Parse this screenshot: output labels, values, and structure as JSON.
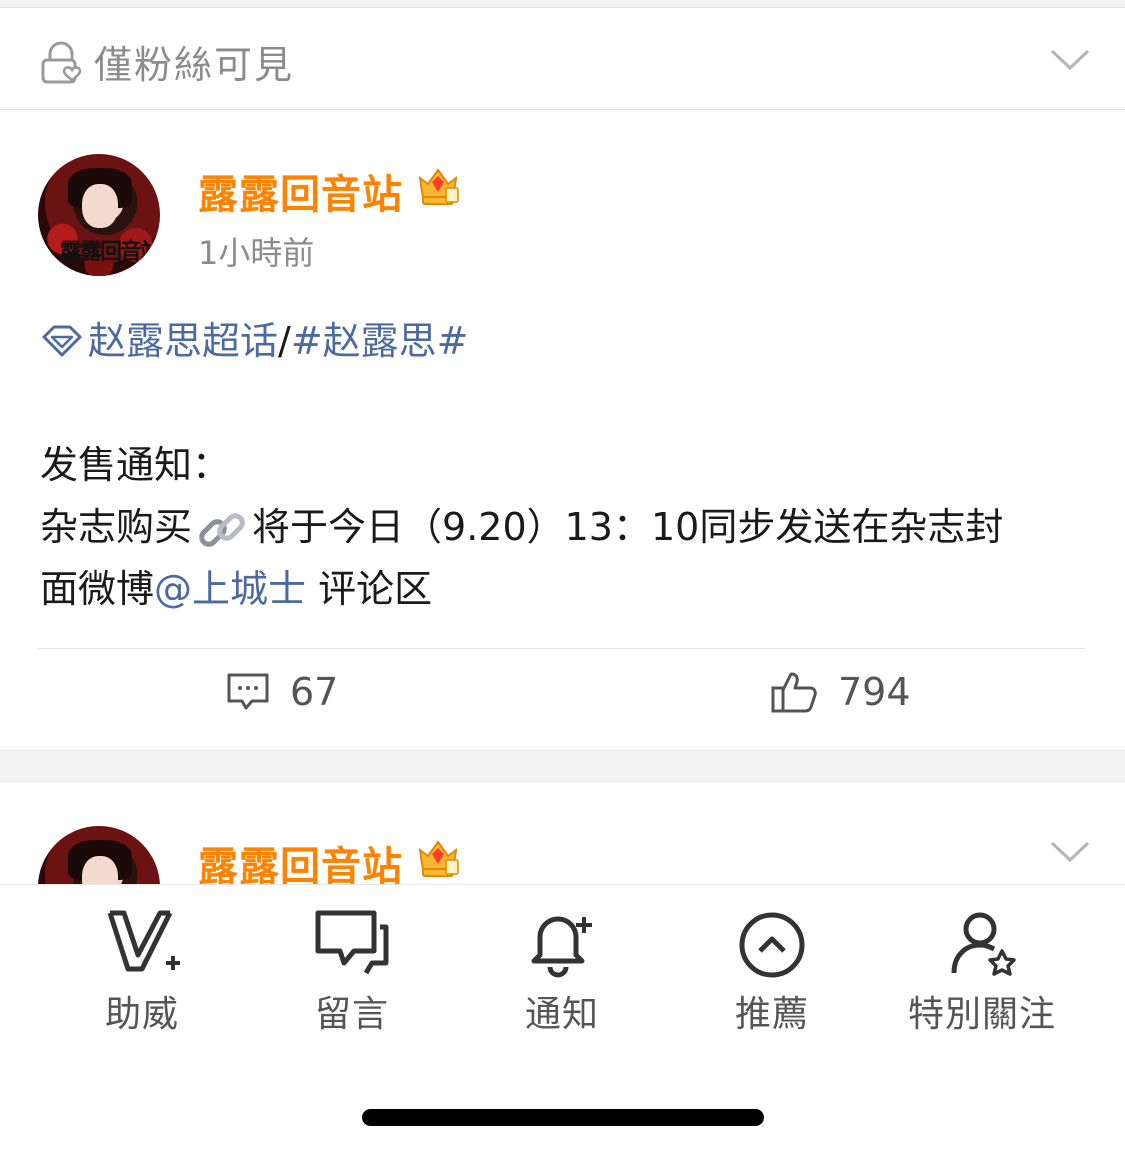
{
  "visibility": {
    "label": "僅粉絲可見"
  },
  "post": {
    "username": "露露回音站",
    "avatar_text": "露露回音站",
    "time": "1小時前",
    "supertopic": "赵露思超话",
    "separator": "/",
    "hashtag": "#赵露思#",
    "line1": "发售通知：",
    "line2_a": "杂志购买",
    "line2_b": "将于今日（9.20）13：10同步发送在杂志封",
    "line3_a": "面微博",
    "mention": "@上城士",
    "line3_b": " 评论区",
    "comments": "67",
    "likes": "794"
  },
  "post2": {
    "username": "露露回音站"
  },
  "tabs": [
    {
      "label": "助威",
      "icon": "v-plus-icon"
    },
    {
      "label": "留言",
      "icon": "message-icon"
    },
    {
      "label": "通知",
      "icon": "bell-plus-icon"
    },
    {
      "label": "推薦",
      "icon": "chevron-up-circle-icon"
    },
    {
      "label": "特別關注",
      "icon": "user-star-icon"
    }
  ],
  "colors": {
    "username": "#ff8200",
    "link": "#4c6a9f",
    "muted": "#8c8c8c"
  }
}
